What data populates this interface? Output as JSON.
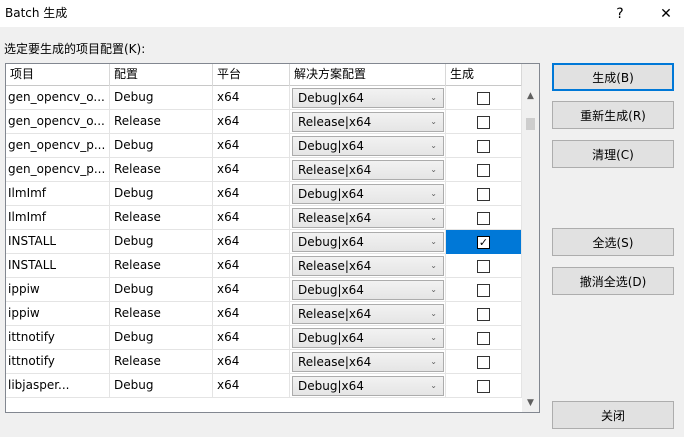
{
  "window": {
    "title": "Batch 生成",
    "help_label": "?",
    "close_label": "✕"
  },
  "prompt": "选定要生成的项目配置(K):",
  "columns": [
    "项目",
    "配置",
    "平台",
    "解决方案配置",
    "生成"
  ],
  "rows": [
    {
      "project": "gen_opencv_o...",
      "config": "Debug",
      "platform": "x64",
      "solution": "Debug|x64",
      "checked": false,
      "selected": false
    },
    {
      "project": "gen_opencv_o...",
      "config": "Release",
      "platform": "x64",
      "solution": "Release|x64",
      "checked": false,
      "selected": false
    },
    {
      "project": "gen_opencv_p...",
      "config": "Debug",
      "platform": "x64",
      "solution": "Debug|x64",
      "checked": false,
      "selected": false
    },
    {
      "project": "gen_opencv_p...",
      "config": "Release",
      "platform": "x64",
      "solution": "Release|x64",
      "checked": false,
      "selected": false
    },
    {
      "project": "IlmImf",
      "config": "Debug",
      "platform": "x64",
      "solution": "Debug|x64",
      "checked": false,
      "selected": false
    },
    {
      "project": "IlmImf",
      "config": "Release",
      "platform": "x64",
      "solution": "Release|x64",
      "checked": false,
      "selected": false
    },
    {
      "project": "INSTALL",
      "config": "Debug",
      "platform": "x64",
      "solution": "Debug|x64",
      "checked": true,
      "selected": true
    },
    {
      "project": "INSTALL",
      "config": "Release",
      "platform": "x64",
      "solution": "Release|x64",
      "checked": false,
      "selected": false
    },
    {
      "project": "ippiw",
      "config": "Debug",
      "platform": "x64",
      "solution": "Debug|x64",
      "checked": false,
      "selected": false
    },
    {
      "project": "ippiw",
      "config": "Release",
      "platform": "x64",
      "solution": "Release|x64",
      "checked": false,
      "selected": false
    },
    {
      "project": "ittnotify",
      "config": "Debug",
      "platform": "x64",
      "solution": "Debug|x64",
      "checked": false,
      "selected": false
    },
    {
      "project": "ittnotify",
      "config": "Release",
      "platform": "x64",
      "solution": "Release|x64",
      "checked": false,
      "selected": false
    },
    {
      "project": "libjasper...",
      "config": "Debug",
      "platform": "x64",
      "solution": "Debug|x64",
      "checked": false,
      "selected": false
    }
  ],
  "buttons": {
    "build": "生成(B)",
    "rebuild": "重新生成(R)",
    "clean": "清理(C)",
    "select_all": "全选(S)",
    "deselect_all": "撤消全选(D)",
    "close": "关闭"
  },
  "icons": {
    "dropdown": "chevron-down-icon",
    "check": "checkmark-icon",
    "scroll_up": "scroll-up-icon",
    "scroll_down": "scroll-down-icon"
  },
  "colors": {
    "selection": "#0078d7",
    "dialog_bg": "#f0f0f0"
  }
}
